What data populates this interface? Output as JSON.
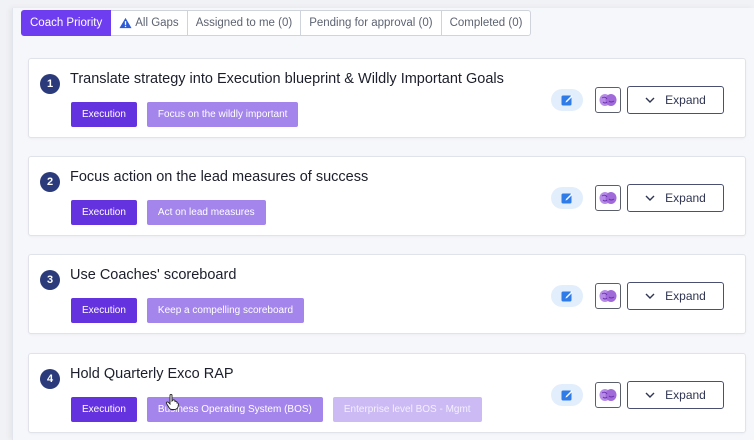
{
  "tabs": [
    {
      "label": "Coach Priority",
      "active": true
    },
    {
      "label": "All Gaps",
      "icon": "warning-icon"
    },
    {
      "label": "Assigned to me (0)"
    },
    {
      "label": "Pending for approval (0)"
    },
    {
      "label": "Completed (0)"
    }
  ],
  "cards": [
    {
      "number": "1",
      "title": "Translate strategy into Execution blueprint & Wildly Important Goals",
      "tags": [
        "Execution",
        "Focus on the wildly important"
      ]
    },
    {
      "number": "2",
      "title": "Focus action on the lead measures of success",
      "tags": [
        "Execution",
        "Act on lead measures"
      ]
    },
    {
      "number": "3",
      "title": "Use Coaches' scoreboard",
      "tags": [
        "Execution",
        "Keep a compelling scoreboard"
      ]
    },
    {
      "number": "4",
      "title": "Hold Quarterly Exco RAP",
      "tags": [
        "Execution",
        "Business Operating System (BOS)",
        "Enterprise level BOS - Mgmt"
      ]
    }
  ],
  "actions": {
    "expand_label": "Expand"
  },
  "colors": {
    "accent": "#6e3df0",
    "tag_primary": "#6532e0",
    "tag_secondary": "#a385ec",
    "badge": "#2b3a7a"
  }
}
